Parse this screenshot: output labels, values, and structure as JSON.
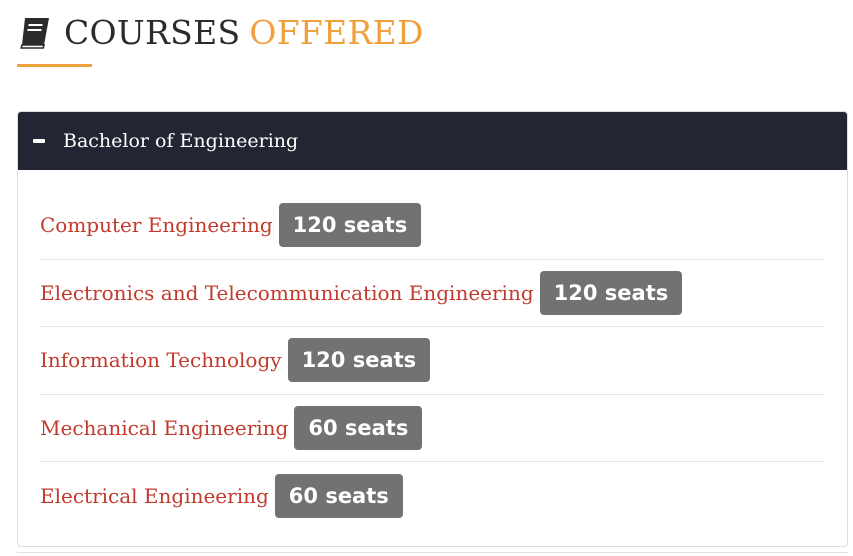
{
  "header": {
    "icon": "book-icon",
    "title_main": "COURSES",
    "title_accent": "OFFERED",
    "accent_color": "#f0a03c"
  },
  "panel": {
    "toggle_icon": "minus-icon",
    "title": "Bachelor of Engineering",
    "header_bg": "#222532",
    "courses": [
      {
        "name": "Computer Engineering",
        "seats": "120 seats"
      },
      {
        "name": "Electronics and Telecommunication Engineering",
        "seats": "120 seats"
      },
      {
        "name": "Information Technology",
        "seats": "120 seats"
      },
      {
        "name": "Mechanical Engineering",
        "seats": "60 seats"
      },
      {
        "name": "Electrical Engineering",
        "seats": "60 seats"
      }
    ],
    "link_color": "#c33a2c",
    "badge_color": "#727272"
  }
}
